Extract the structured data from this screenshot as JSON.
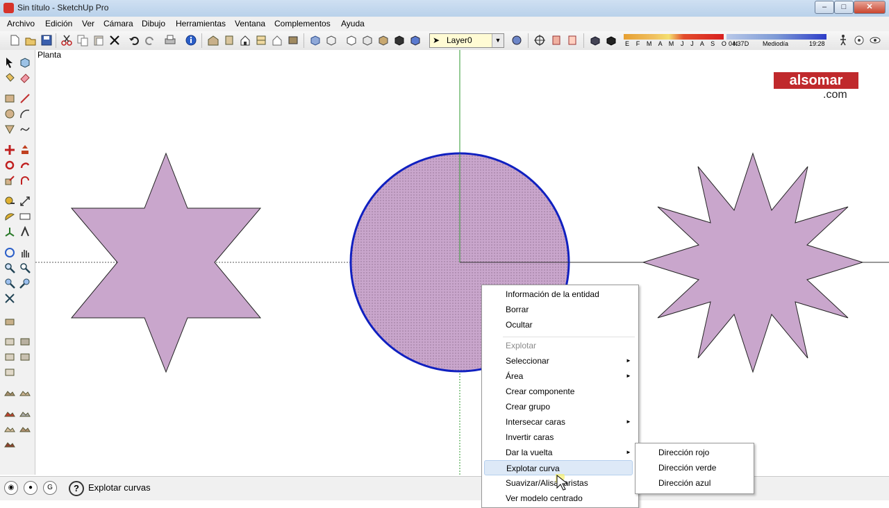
{
  "window": {
    "title": "Sin título - SketchUp Pro",
    "buttons": {
      "minimize": "‒",
      "maximize": "□",
      "close": "✕"
    }
  },
  "menu": [
    "Archivo",
    "Edición",
    "Ver",
    "Cámara",
    "Dibujo",
    "Herramientas",
    "Ventana",
    "Complementos",
    "Ayuda"
  ],
  "toolbar": {
    "layer": "Layer0",
    "shadow_months": "E F M A M J J A S O N D",
    "time_start": "04:37",
    "time_mid": "Mediodía",
    "time_end": "19:28"
  },
  "scene": {
    "tab": "Planta"
  },
  "logo": {
    "main": "alsomar",
    "sub": ".com"
  },
  "status": {
    "help": "?",
    "text": "Explotar curvas"
  },
  "context_menu": {
    "items": [
      "Información de la entidad",
      "Borrar",
      "Ocultar",
      "Explotar",
      "Seleccionar",
      "Área",
      "Crear componente",
      "Crear grupo",
      "Intersecar caras",
      "Invertir caras",
      "Dar la vuelta",
      "Explotar curva",
      "Suavizar/Alisar aristas",
      "Ver modelo centrado"
    ],
    "submenu_arrow": "►"
  },
  "submenu": {
    "items": [
      "Dirección rojo",
      "Dirección verde",
      "Dirección azul"
    ]
  },
  "colors": {
    "face": "#c9a6cc",
    "axis_green": "#2e9a2e",
    "circle_edge": "#1020c0",
    "logo_bg": "#c0292c"
  }
}
